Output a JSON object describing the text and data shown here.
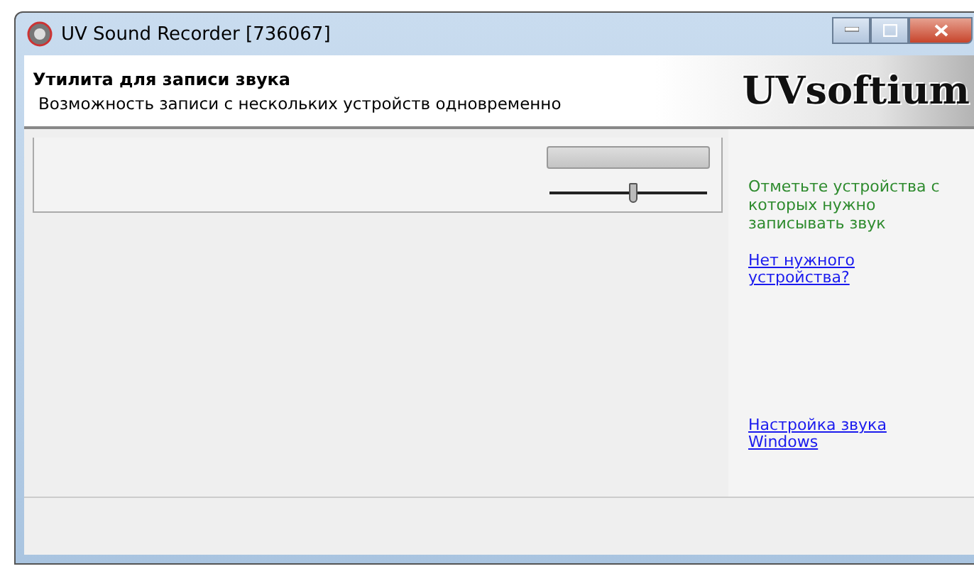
{
  "window": {
    "title": "UV Sound Recorder [736067]"
  },
  "header": {
    "title": "Утилита для записи звука",
    "subtitle": "Возможность записи с нескольких устройств одновременно",
    "logo": "UVsoftium"
  },
  "device": {
    "volume": {
      "level": 0.53
    }
  },
  "side_panel": {
    "hint": "Отметьте устройства с которых нужно записывать звук",
    "links": [
      "Нет нужного устройства?",
      "Настройка звука Windows"
    ]
  }
}
